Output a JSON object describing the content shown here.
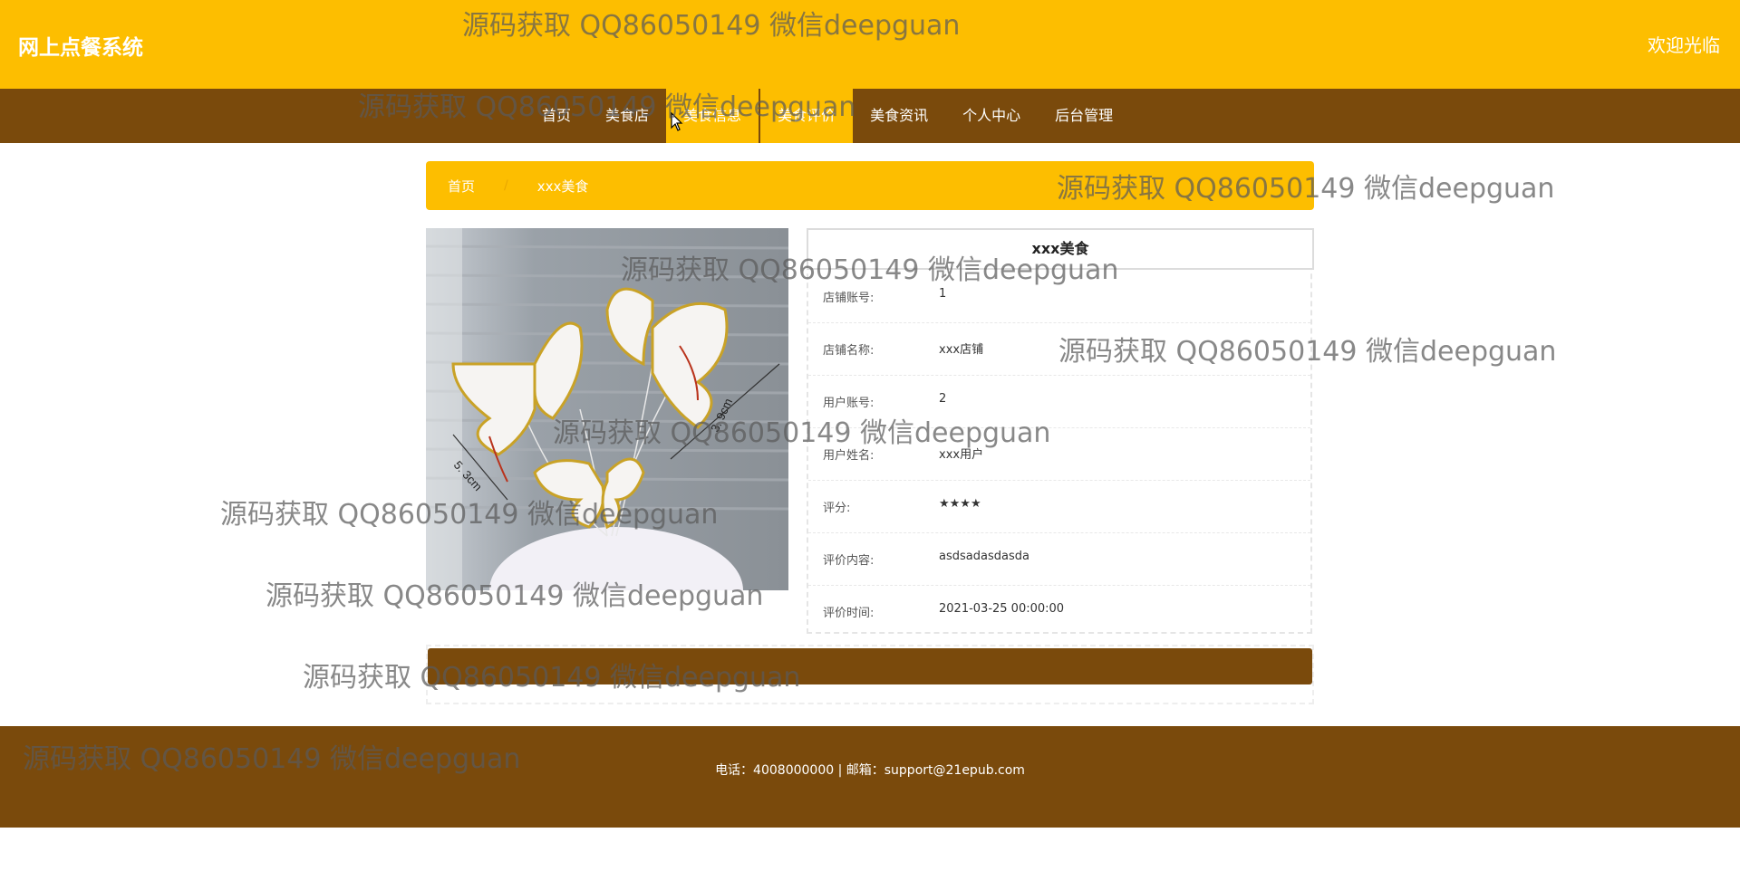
{
  "header": {
    "site_title": "网上点餐系统",
    "welcome": "欢迎光临"
  },
  "nav": {
    "items": [
      {
        "label": "首页"
      },
      {
        "label": "美食店"
      },
      {
        "label": "美食信息"
      },
      {
        "label": "美食评价"
      },
      {
        "label": "美食资讯"
      },
      {
        "label": "个人中心"
      },
      {
        "label": "后台管理"
      }
    ],
    "active": "美食评价"
  },
  "breadcrumb": {
    "home": "首页",
    "separator": "/",
    "current": "xxx美食"
  },
  "detail": {
    "title": "xxx美食",
    "rows": [
      {
        "label": "店铺账号:",
        "value": "1"
      },
      {
        "label": "店铺名称:",
        "value": "xxx店铺"
      },
      {
        "label": "用户账号:",
        "value": "2"
      },
      {
        "label": "用户姓名:",
        "value": "xxx用户"
      },
      {
        "label": "评分:",
        "value": "★★★★"
      },
      {
        "label": "评价内容:",
        "value": "asdsadasdasda"
      },
      {
        "label": "评价时间:",
        "value": "2021-03-25 00:00:00"
      }
    ],
    "rating": 4
  },
  "footer": {
    "text": "电话：4008000000 | 邮箱：support@21epub.com"
  },
  "watermark": {
    "text": "源码获取 QQ86050149 微信deepguan"
  },
  "image_annotations": {
    "left_size": "5. 3cm",
    "right_size": "3. 9cm"
  },
  "colors": {
    "primary_yellow": "#FDBE00",
    "primary_brown": "#7A4A0C"
  }
}
